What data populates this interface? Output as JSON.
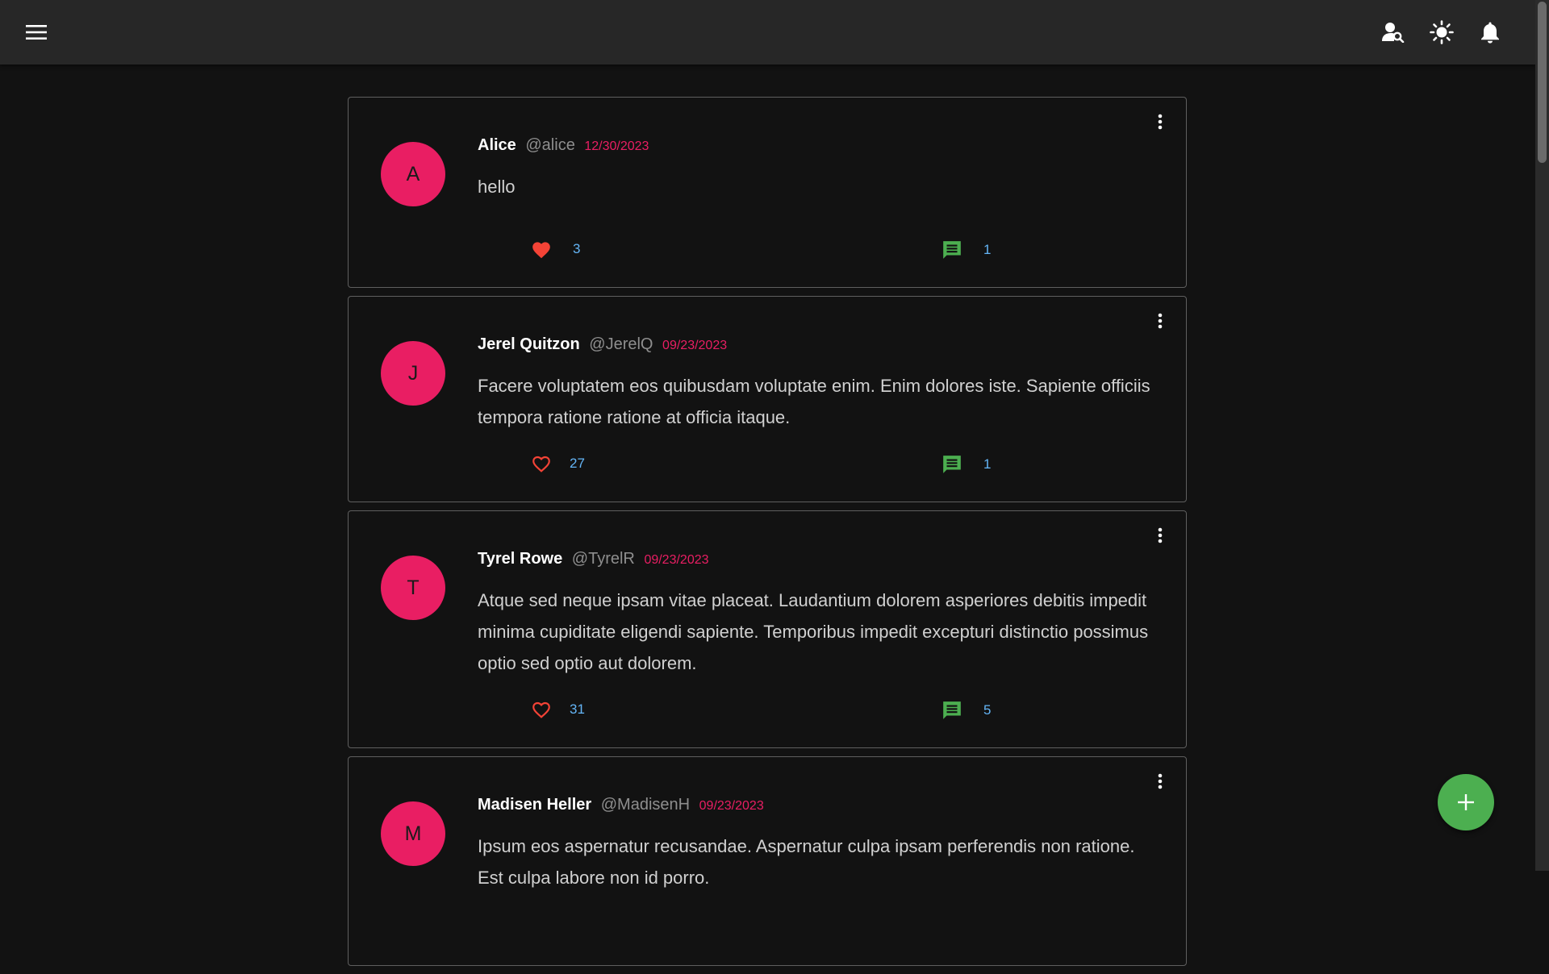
{
  "appbar": {
    "menu_icon": "menu-icon",
    "right_icons": [
      "person-search-icon",
      "brightness-icon",
      "bell-icon"
    ]
  },
  "colors": {
    "accent": "#e91e63",
    "like": "#f44336",
    "comment": "#4caf50",
    "count": "#64b5f6",
    "fab": "#4caf50"
  },
  "posts": [
    {
      "initial": "A",
      "name": "Alice",
      "handle": "@alice",
      "date": "12/30/2023",
      "text": "hello",
      "liked": true,
      "likes": "3",
      "comments": "1"
    },
    {
      "initial": "J",
      "name": "Jerel Quitzon",
      "handle": "@JerelQ",
      "date": "09/23/2023",
      "text": "Facere voluptatem eos quibusdam voluptate enim. Enim dolores iste. Sapiente officiis tempora ratione ratione at officia itaque.",
      "liked": false,
      "likes": "27",
      "comments": "1"
    },
    {
      "initial": "T",
      "name": "Tyrel Rowe",
      "handle": "@TyrelR",
      "date": "09/23/2023",
      "text": "Atque sed neque ipsam vitae placeat. Laudantium dolorem asperiores debitis impedit minima cupiditate eligendi sapiente. Temporibus impedit excepturi distinctio possimus optio sed optio aut dolorem.",
      "liked": false,
      "likes": "31",
      "comments": "5"
    },
    {
      "initial": "M",
      "name": "Madisen Heller",
      "handle": "@MadisenH",
      "date": "09/23/2023",
      "text": "Ipsum eos aspernatur recusandae. Aspernatur culpa ipsam perferendis non ratione. Est culpa labore non id porro.",
      "liked": false,
      "likes": "",
      "comments": ""
    }
  ],
  "fab": {
    "icon": "plus-icon"
  }
}
